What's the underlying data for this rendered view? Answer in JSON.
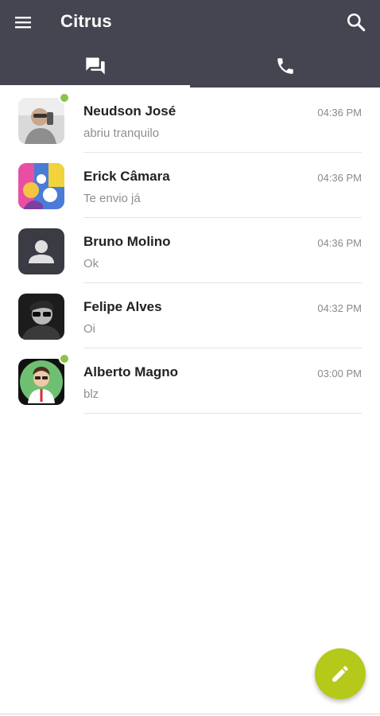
{
  "app": {
    "title": "Citrus",
    "header_color": "#454552",
    "accent_color": "#b5c91b",
    "online_color": "#8bc34a"
  },
  "toolbar": {
    "menu_icon": "hamburger-menu-icon",
    "search_icon": "search-icon"
  },
  "tabs": [
    {
      "name": "chats",
      "icon": "chat-bubbles-icon",
      "active": true
    },
    {
      "name": "calls",
      "icon": "phone-icon",
      "active": false
    }
  ],
  "chats": [
    {
      "name": "Neudson José",
      "preview": "abriu tranquilo",
      "time": "04:36 PM",
      "online": true
    },
    {
      "name": "Erick Câmara",
      "preview": "Te envio já",
      "time": "04:36 PM",
      "online": false
    },
    {
      "name": "Bruno Molino",
      "preview": "Ok",
      "time": "04:36 PM",
      "online": false
    },
    {
      "name": "Felipe Alves",
      "preview": "Oi",
      "time": "04:32 PM",
      "online": false
    },
    {
      "name": "Alberto Magno",
      "preview": "blz",
      "time": "03:00 PM",
      "online": true
    }
  ],
  "fab": {
    "icon": "pencil-edit-icon"
  }
}
